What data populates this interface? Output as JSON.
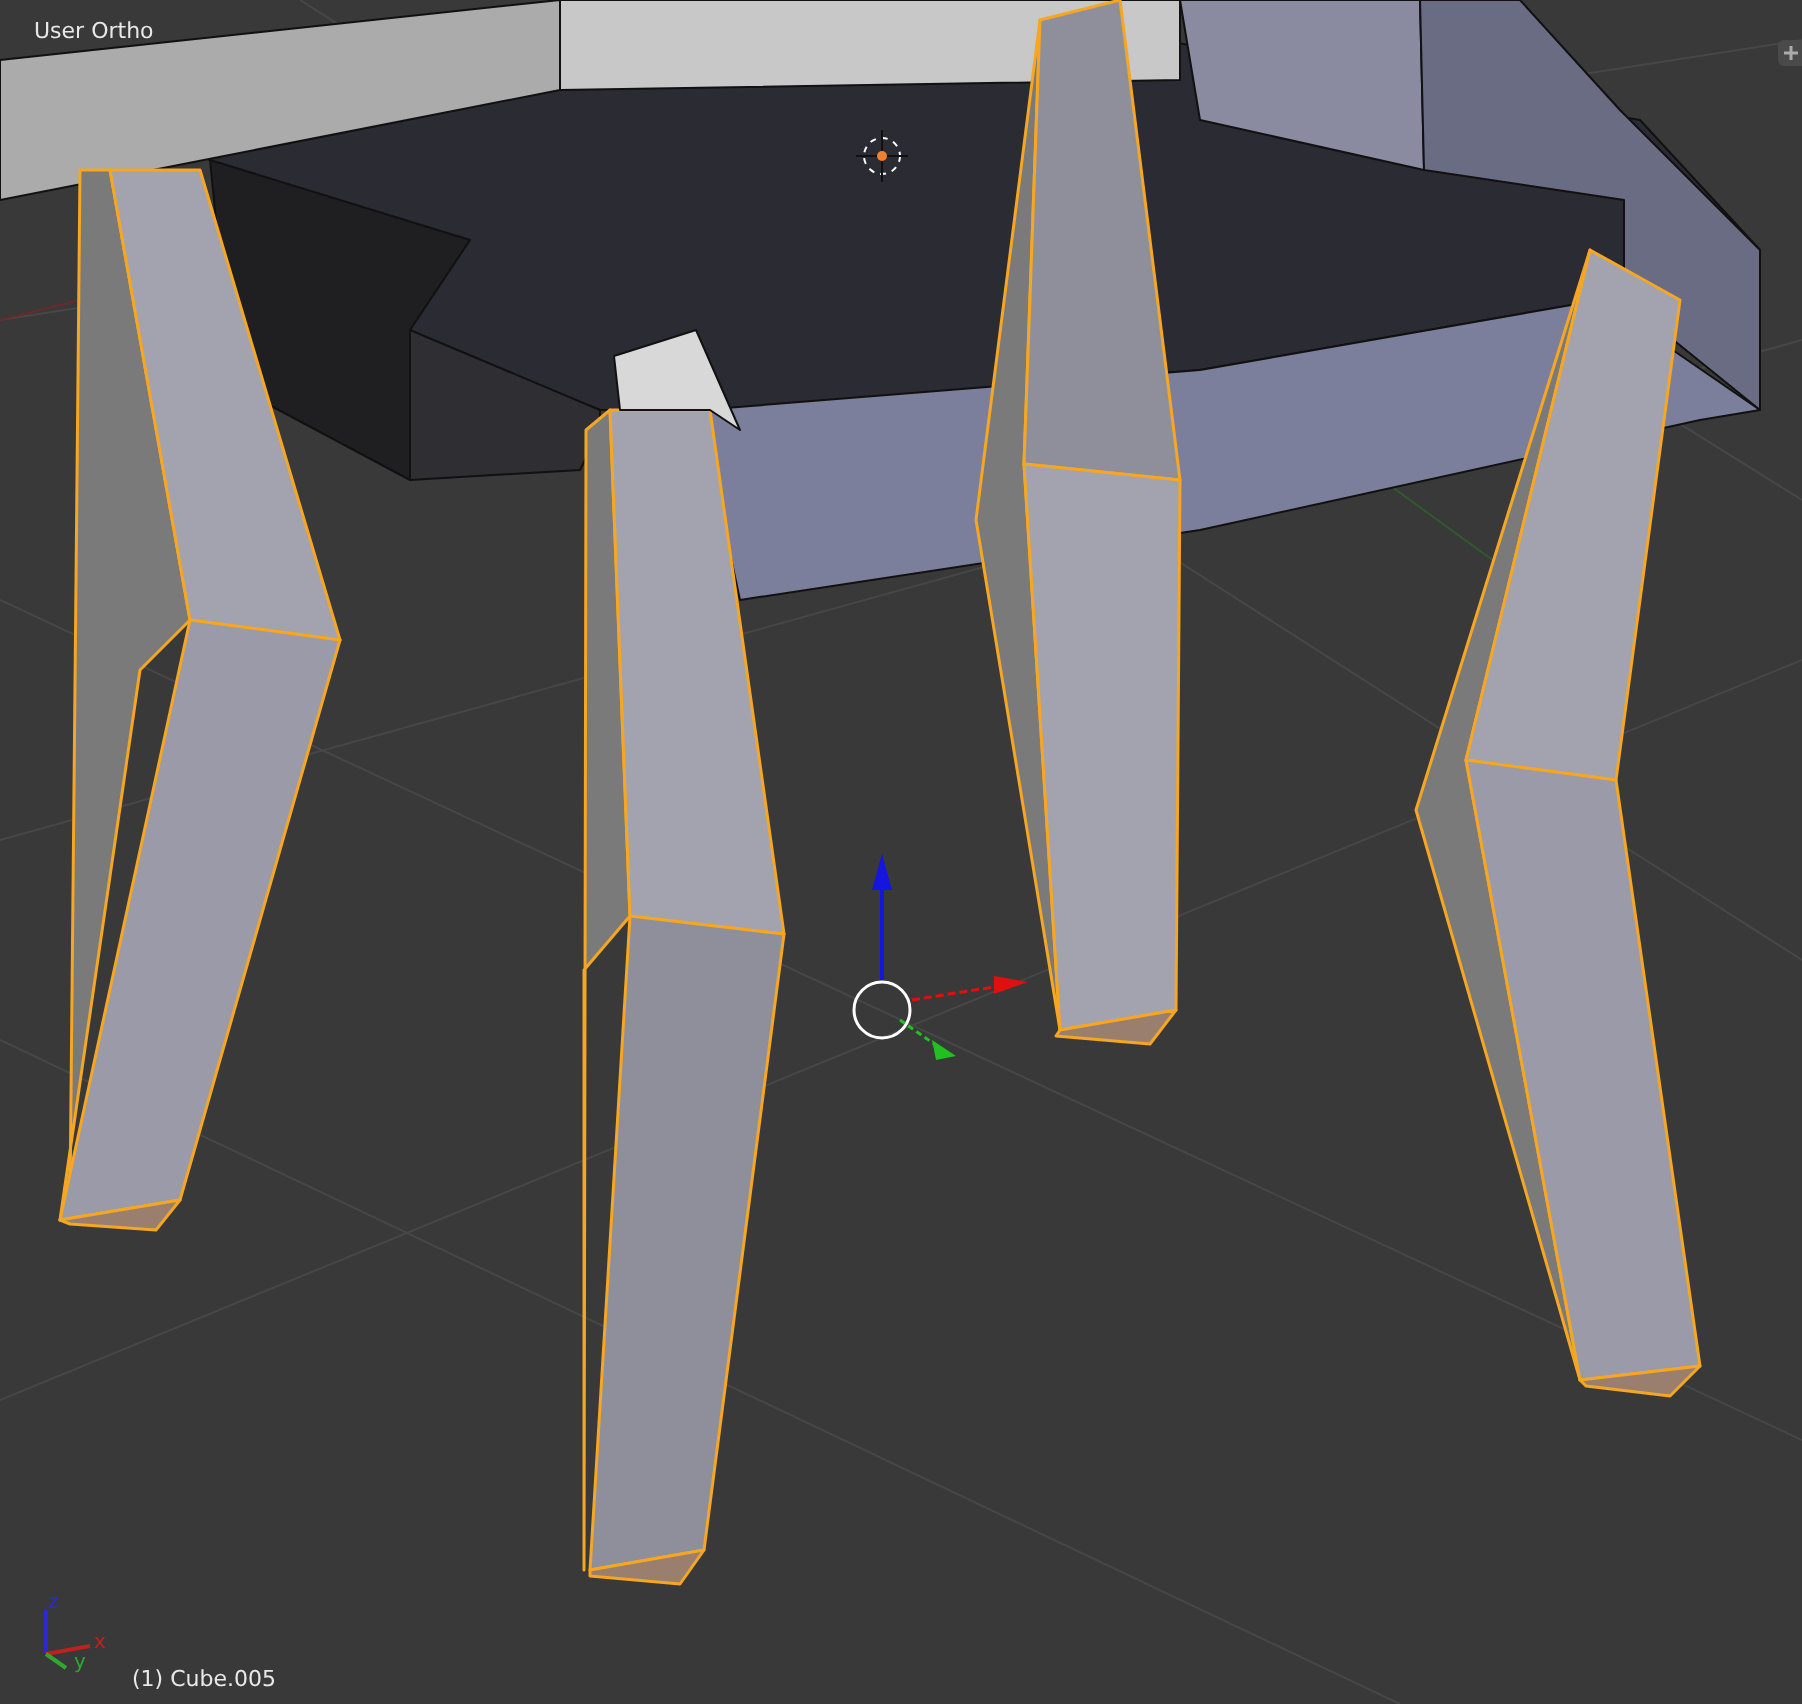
{
  "viewport": {
    "view_name": "User Ortho",
    "object_info": "(1) Cube.005",
    "axes": [
      {
        "label": "z",
        "color": "#2a2ad0"
      },
      {
        "label": "x",
        "color": "#c0201e"
      },
      {
        "label": "y",
        "color": "#2ea82e"
      }
    ]
  }
}
